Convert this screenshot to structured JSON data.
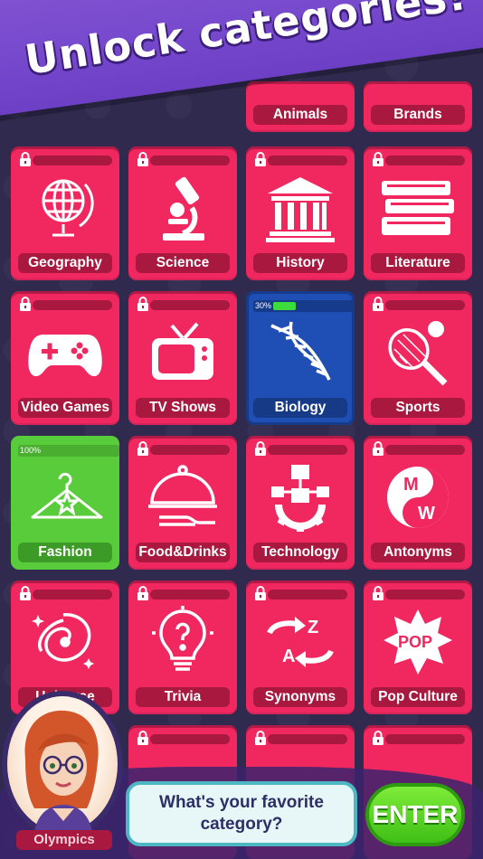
{
  "banner": {
    "title": "Unlock categories!"
  },
  "top_row": [
    {
      "label": "Animals"
    },
    {
      "label": "Brands"
    }
  ],
  "categories": [
    {
      "label": "Geography",
      "icon": "globe-icon",
      "state": "locked"
    },
    {
      "label": "Science",
      "icon": "microscope-icon",
      "state": "locked"
    },
    {
      "label": "History",
      "icon": "temple-icon",
      "state": "locked"
    },
    {
      "label": "Literature",
      "icon": "books-icon",
      "state": "locked"
    },
    {
      "label": "Video Games",
      "icon": "gamepad-icon",
      "state": "locked"
    },
    {
      "label": "TV Shows",
      "icon": "tv-icon",
      "state": "locked"
    },
    {
      "label": "Biology",
      "icon": "dna-icon",
      "state": "in-progress",
      "progress_text": "30%",
      "progress": 0.3
    },
    {
      "label": "Sports",
      "icon": "tennis-racket-icon",
      "state": "locked"
    },
    {
      "label": "Fashion",
      "icon": "hanger-icon",
      "state": "complete",
      "progress_text": "100%",
      "progress": 1.0
    },
    {
      "label": "Food&Drinks",
      "icon": "cloche-icon",
      "state": "locked"
    },
    {
      "label": "Technology",
      "icon": "circuit-gear-icon",
      "state": "locked"
    },
    {
      "label": "Antonyms",
      "icon": "yin-yang-mw-icon",
      "state": "locked"
    },
    {
      "label": "Universe",
      "icon": "galaxy-icon",
      "state": "locked"
    },
    {
      "label": "Trivia",
      "icon": "lightbulb-question-icon",
      "state": "locked"
    },
    {
      "label": "Synonyms",
      "icon": "az-arrows-icon",
      "state": "locked"
    },
    {
      "label": "Pop Culture",
      "icon": "pop-burst-icon",
      "state": "locked"
    }
  ],
  "mono_icon_letters": {
    "antonyms": [
      "M",
      "W"
    ],
    "synonyms": [
      "A",
      "Z"
    ],
    "pop": "POP"
  },
  "bottom": {
    "partial_label": "Olympics",
    "prompt": "What's your favorite category?",
    "enter_label": "ENTER"
  },
  "colors": {
    "tile_pink": "#f0285f",
    "tile_blue": "#1f4fb5",
    "tile_green": "#58cc3a",
    "banner_purple": "#7b4cd0",
    "background": "#2f2a4e"
  }
}
